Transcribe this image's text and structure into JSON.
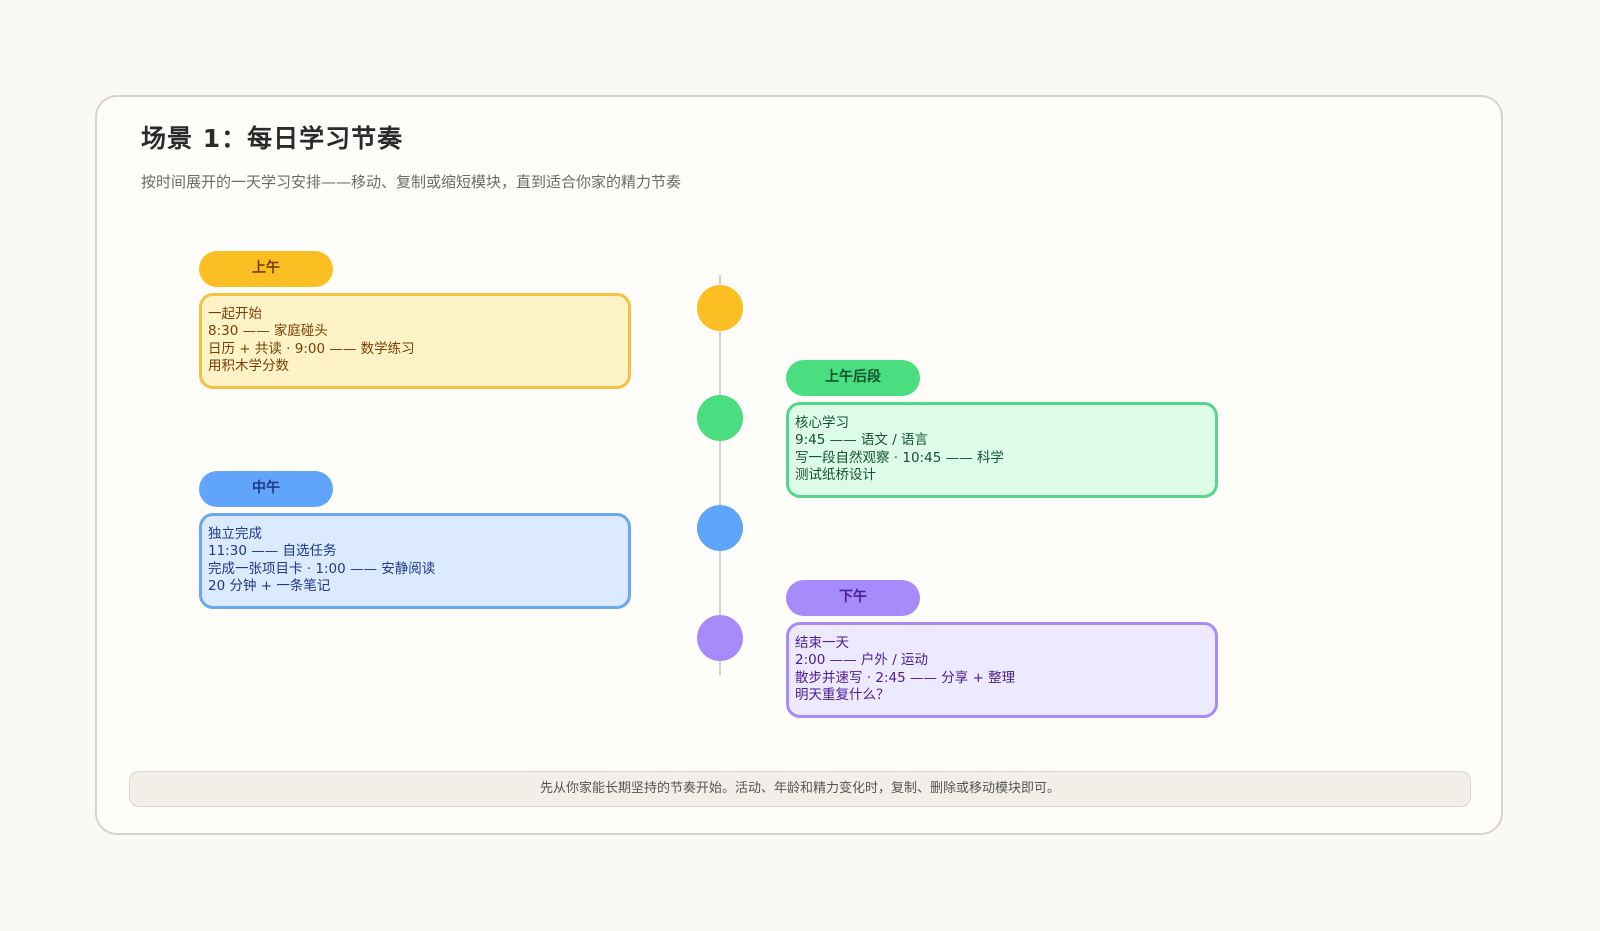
{
  "scene": {
    "title": "场景 1：每日学习节奏",
    "subtitle": "按时间展开的一天学习安排——移动、复制或缩短模块，直到适合你家的精力节奏"
  },
  "blocks": [
    {
      "period": "上午",
      "lines": [
        "一起开始",
        "8:30 —— 家庭碰头",
        "日历 + 共读 · 9:00 —— 数学练习",
        "用积木学分数"
      ],
      "color": "#fbbf24"
    },
    {
      "period": "上午后段",
      "lines": [
        "核心学习",
        "9:45 —— 语文 / 语言",
        "写一段自然观察 · 10:45 —— 科学",
        "测试纸桥设计"
      ],
      "color": "#4ade80"
    },
    {
      "period": "中午",
      "lines": [
        "独立完成",
        "11:30 —— 自选任务",
        "完成一张项目卡 · 1:00 —— 安静阅读",
        "20 分钟 + 一条笔记"
      ],
      "color": "#60a5fa"
    },
    {
      "period": "下午",
      "lines": [
        "结束一天",
        "2:00 —— 户外 / 运动",
        "散步并速写 · 2:45 —— 分享 + 整理",
        "明天重复什么？"
      ],
      "color": "#a78bfa"
    }
  ],
  "footer": {
    "note": "先从你家能长期坚持的节奏开始。活动、年龄和精力变化时，复制、删除或移动模块即可。"
  }
}
